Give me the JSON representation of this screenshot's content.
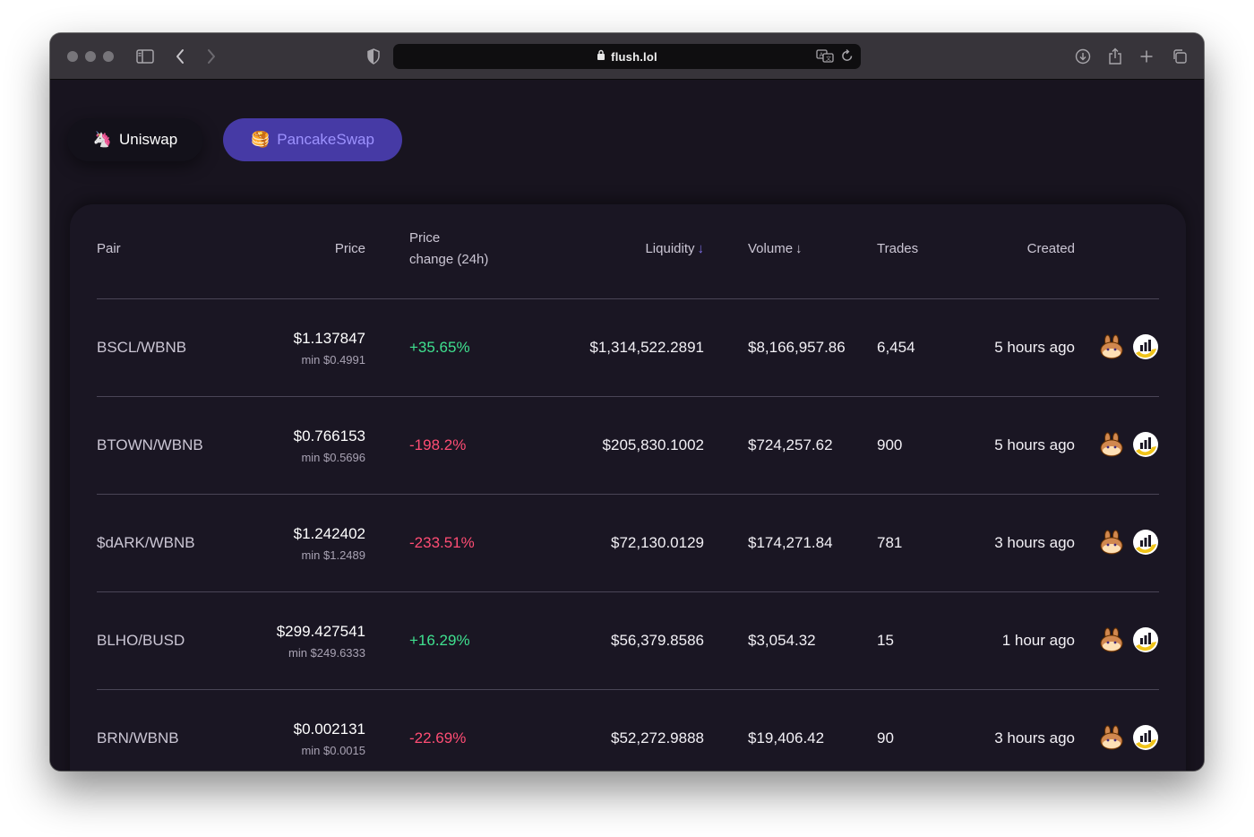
{
  "browser": {
    "url": "flush.lol"
  },
  "dex_tabs": [
    {
      "label": "Uniswap",
      "icon": "unicorn-icon",
      "emoji": "🦄"
    },
    {
      "label": "PancakeSwap",
      "icon": "pancake-icon",
      "emoji": "🥞"
    }
  ],
  "table": {
    "headers": {
      "pair": "Pair",
      "price": "Price",
      "price_change_line1": "Price",
      "price_change_line2": "change (24h)",
      "liquidity": "Liquidity",
      "volume": "Volume",
      "trades": "Trades",
      "created": "Created",
      "sort_arrow": "↓"
    },
    "rows": [
      {
        "pair": "BSCL/WBNB",
        "price": "$1.137847",
        "min": "min $0.4991",
        "change": "+35.65%",
        "liquidity": "$1,314,522.2891",
        "volume": "$8,166,957.86",
        "trades": "6,454",
        "created": "5 hours ago"
      },
      {
        "pair": "BTOWN/WBNB",
        "price": "$0.766153",
        "min": "min $0.5696",
        "change": "-198.2%",
        "liquidity": "$205,830.1002",
        "volume": "$724,257.62",
        "trades": "900",
        "created": "5 hours ago"
      },
      {
        "pair": "$dARK/WBNB",
        "price": "$1.242402",
        "min": "min $1.2489",
        "change": "-233.51%",
        "liquidity": "$72,130.0129",
        "volume": "$174,271.84",
        "trades": "781",
        "created": "3 hours ago"
      },
      {
        "pair": "BLHO/BUSD",
        "price": "$299.427541",
        "min": "min $249.6333",
        "change": "+16.29%",
        "liquidity": "$56,379.8586",
        "volume": "$3,054.32",
        "trades": "15",
        "created": "1 hour ago"
      },
      {
        "pair": "BRN/WBNB",
        "price": "$0.002131",
        "min": "min $0.0015",
        "change": "-22.69%",
        "liquidity": "$52,272.9888",
        "volume": "$19,406.42",
        "trades": "90",
        "created": "3 hours ago"
      }
    ]
  },
  "colors": {
    "background": "#18141f",
    "accent": "#463aa5",
    "positive": "#3fe08f",
    "negative": "#ff4d74"
  }
}
